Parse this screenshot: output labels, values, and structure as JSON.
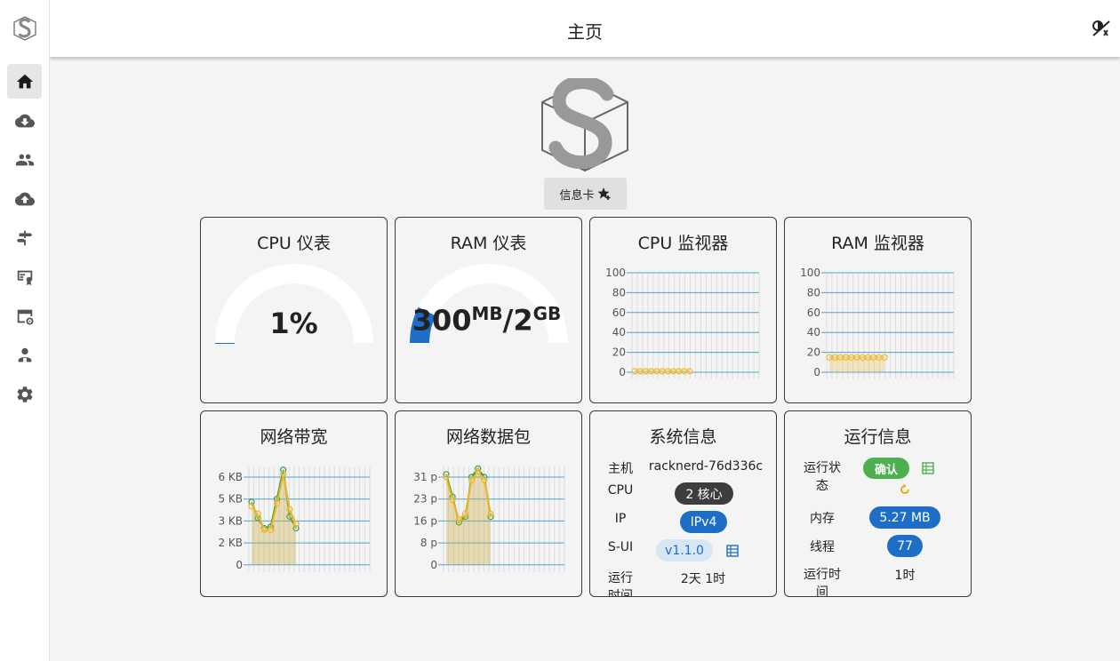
{
  "header": {
    "title": "主页",
    "theme_icon": "theme-toggle-icon"
  },
  "sidebar": {
    "items": [
      {
        "name": "home",
        "icon": "home-icon",
        "active": true
      },
      {
        "name": "inbounds",
        "icon": "cloud-download-icon"
      },
      {
        "name": "clients",
        "icon": "users-icon"
      },
      {
        "name": "outbounds",
        "icon": "cloud-upload-icon"
      },
      {
        "name": "rules",
        "icon": "signpost-icon"
      },
      {
        "name": "tls",
        "icon": "certificate-icon"
      },
      {
        "name": "basics",
        "icon": "web-settings-icon"
      },
      {
        "name": "admins",
        "icon": "admin-icon"
      },
      {
        "name": "settings",
        "icon": "gear-icon"
      }
    ]
  },
  "info_button": {
    "label": "信息卡"
  },
  "cards": {
    "cpu_gauge": {
      "title": "CPU 仪表",
      "value": "1%",
      "percent": 1
    },
    "ram_gauge": {
      "title": "RAM 仪表",
      "used": "300",
      "used_unit": "MB",
      "sep": "/",
      "total": "2",
      "total_unit": "GB",
      "percent": 15
    },
    "cpu_monitor": {
      "title": "CPU 监视器"
    },
    "ram_monitor": {
      "title": "RAM 监视器"
    },
    "net_bandwidth": {
      "title": "网络带宽"
    },
    "net_packets": {
      "title": "网络数据包"
    },
    "system_info": {
      "title": "系统信息",
      "host_label": "主机",
      "host_value": "racknerd-76d336c",
      "cpu_label": "CPU",
      "cpu_value": "2 核心",
      "ip_label": "IP",
      "ip_value": "IPv4",
      "sui_label": "S-UI",
      "sui_value": "v1.1.0",
      "uptime_label": "运行时间",
      "uptime_value": "2天 1时"
    },
    "run_info": {
      "title": "运行信息",
      "status_label": "运行状态",
      "status_value": "确认",
      "memory_label": "内存",
      "memory_value": "5.27 MB",
      "threads_label": "线程",
      "threads_value": "77",
      "uptime_label": "运行时间",
      "uptime_value": "1时"
    }
  },
  "chart_data": [
    {
      "type": "line",
      "title": "CPU 监视器",
      "yticks": [
        "100",
        "80",
        "60",
        "40",
        "20",
        "0"
      ],
      "ylim": [
        0,
        100
      ],
      "series": [
        {
          "values": [
            1,
            1,
            1,
            1,
            1,
            1,
            1,
            1,
            1,
            1,
            1
          ],
          "color": "#f0b429"
        }
      ],
      "grid": true
    },
    {
      "type": "area",
      "title": "RAM 监视器",
      "yticks": [
        "100",
        "80",
        "60",
        "40",
        "20",
        "0"
      ],
      "ylim": [
        0,
        100
      ],
      "series": [
        {
          "values": [
            15,
            15,
            15,
            15,
            15,
            15,
            15,
            15,
            15,
            15,
            15
          ],
          "color": "#f0b429"
        }
      ],
      "grid": true
    },
    {
      "type": "area",
      "title": "网络带宽",
      "yticks": [
        "6 KB",
        "5 KB",
        "3 KB",
        "2 KB",
        "0"
      ],
      "ylim": [
        0,
        6.5
      ],
      "series": [
        {
          "values": [
            4.3,
            3.2,
            2.5,
            2.6,
            4.5,
            6.5,
            3.3,
            2.5
          ],
          "color": "#2e9e3a"
        },
        {
          "values": [
            4.0,
            3.5,
            2.4,
            2.4,
            4.2,
            6.2,
            3.8,
            2.8
          ],
          "color": "#f0b429"
        }
      ],
      "grid": true
    },
    {
      "type": "area",
      "title": "网络数据包",
      "yticks": [
        "31 p",
        "23 p",
        "16 p",
        "8 p",
        "0"
      ],
      "ylim": [
        0,
        34
      ],
      "series": [
        {
          "values": [
            32,
            24,
            15,
            17,
            31,
            34,
            31,
            17
          ],
          "color": "#2e9e3a"
        },
        {
          "values": [
            31,
            23,
            16,
            18,
            30,
            33,
            30,
            18
          ],
          "color": "#f0b429"
        }
      ],
      "grid": true
    }
  ]
}
